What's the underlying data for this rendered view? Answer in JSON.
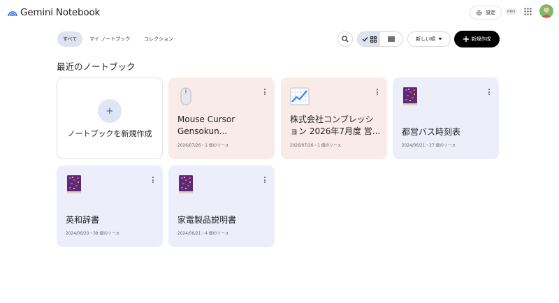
{
  "app": {
    "title": "Gemini Notebook"
  },
  "header": {
    "settings_label": "設定",
    "pro_badge": "PRO",
    "icons": [
      "gemini-logo-icon",
      "gear-icon",
      "apps-grid-icon",
      "avatar"
    ]
  },
  "filters": {
    "items": [
      "すべて",
      "マイ ノートブック",
      "コレクション"
    ],
    "active": "すべて"
  },
  "toolbar": {
    "sort_label": "新しい順",
    "new_label": "新規作成",
    "view_selected": "grid"
  },
  "section": {
    "title": "最近のノートブック"
  },
  "create_card": {
    "label": "ノートブックを新規作成",
    "plus": "+"
  },
  "notebooks": [
    {
      "title": "Mouse Cursor Gensokun...",
      "meta": "2026/07/26・1 個のソース",
      "icon": "computer-mouse-icon",
      "tone": "pink"
    },
    {
      "title": "株式会社コンプレッション 2026年7月度 営...",
      "meta": "2026/07/26・1 個のソース",
      "icon": "chart-increasing-icon",
      "tone": "pink"
    },
    {
      "title": "都営バス時刻表",
      "meta": "2024/06/21・27 個のソース",
      "icon": "book-icon",
      "tone": "blue"
    },
    {
      "title": "英和辞書",
      "meta": "2024/06/20・38 個のソース",
      "icon": "book-icon",
      "tone": "blue"
    },
    {
      "title": "家電製品説明書",
      "meta": "2024/06/21・4 個のソース",
      "icon": "book-icon",
      "tone": "blue"
    }
  ],
  "colors": {
    "accent_dark": "#000000",
    "card_pink": "#f8ebe8",
    "card_blue": "#eceefa",
    "chip_active": "#dde3f0"
  }
}
